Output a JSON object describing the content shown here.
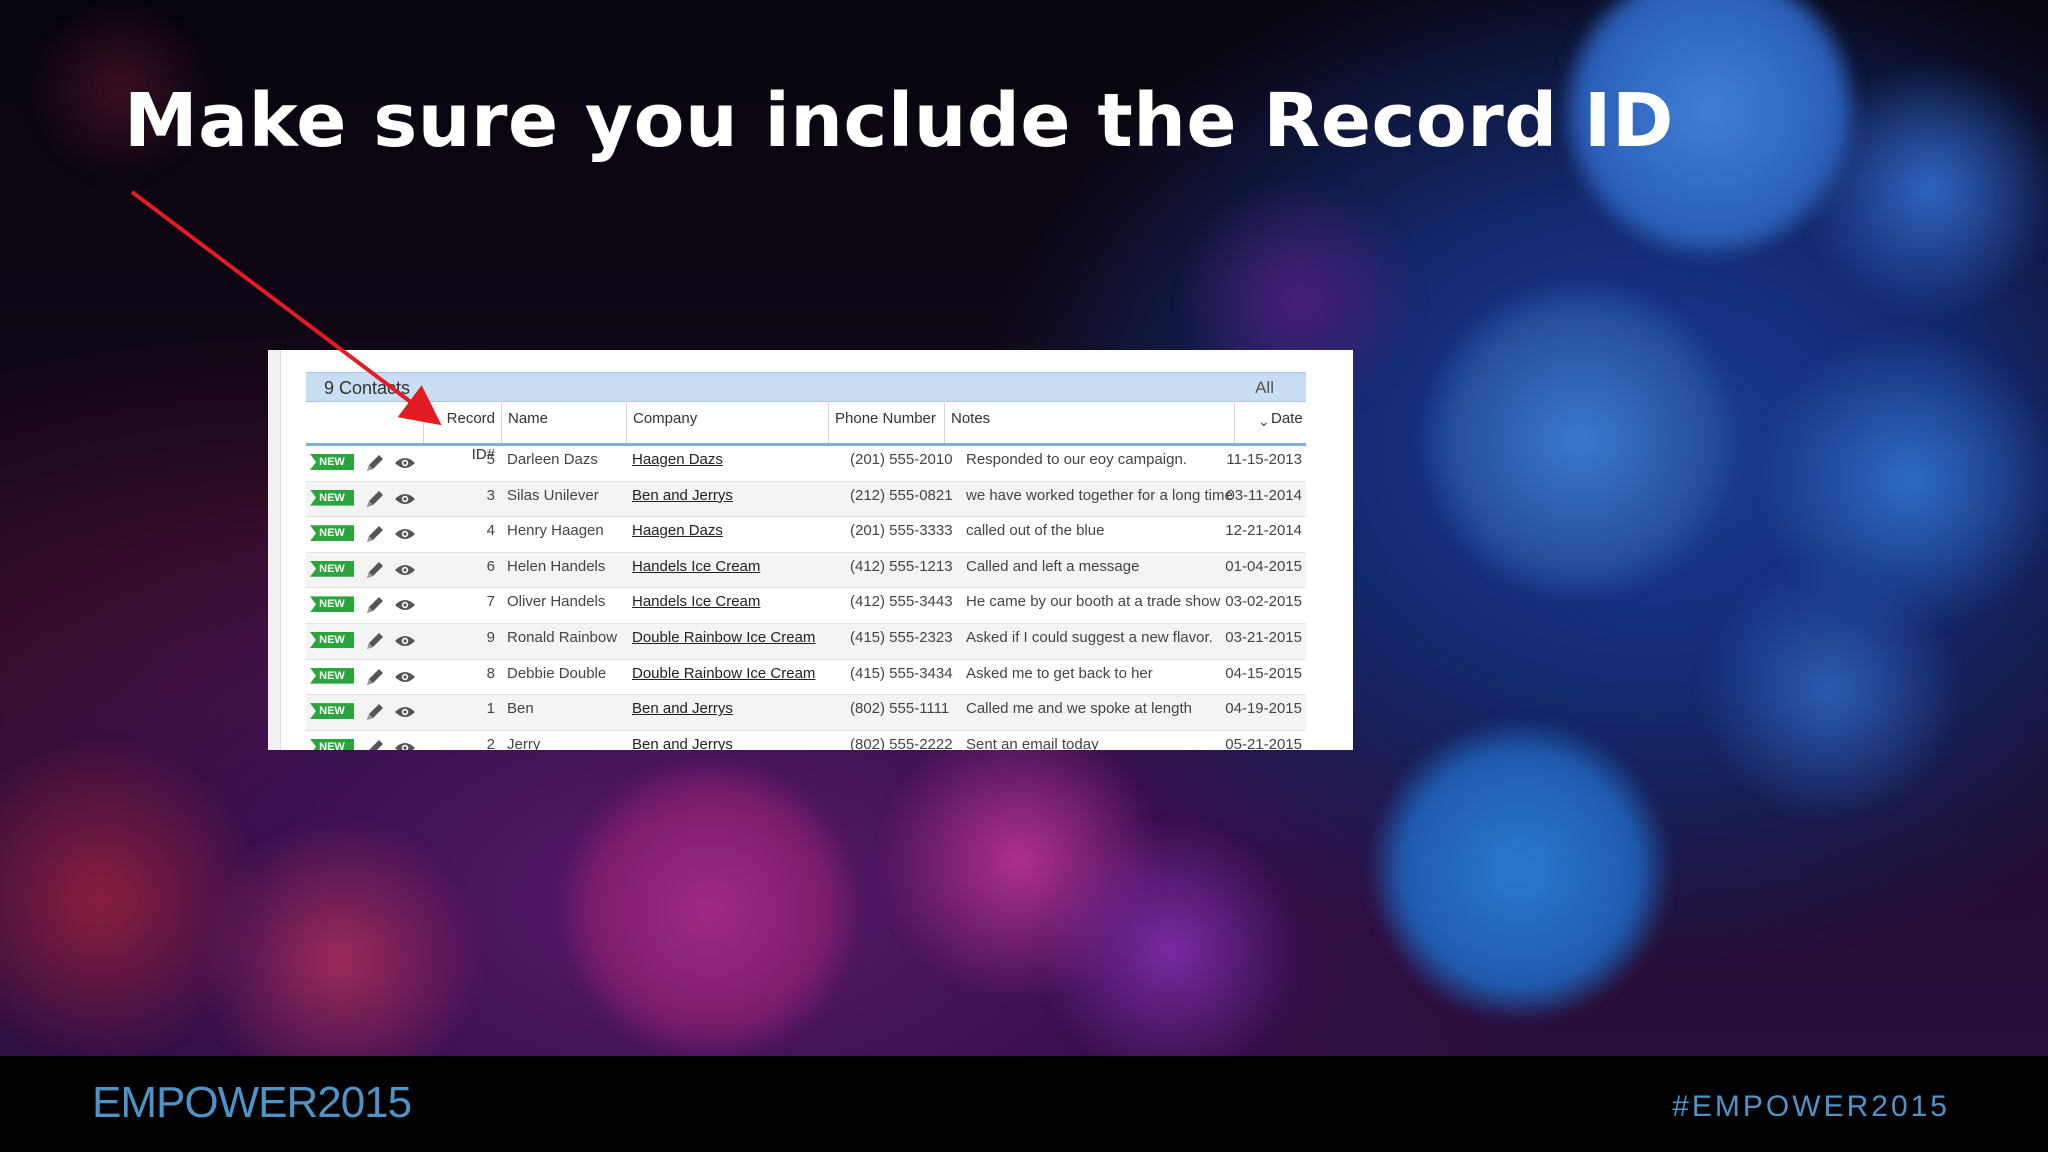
{
  "slide": {
    "title": "Make sure you include the Record ID"
  },
  "grid": {
    "count_label": "9 Contacts",
    "view_filter": "All",
    "columns": {
      "record_id": "Record ID#",
      "name": "Name",
      "company": "Company",
      "phone": "Phone Number",
      "notes": "Notes",
      "date": "Date"
    },
    "badge_label": "NEW",
    "rows": [
      {
        "id": "5",
        "name": "Darleen Dazs",
        "company": "Haagen Dazs",
        "phone": "(201) 555-2010",
        "notes": "Responded to our eoy campaign.",
        "date": "11-15-2013"
      },
      {
        "id": "3",
        "name": "Silas Unilever",
        "company": "Ben and Jerrys",
        "phone": "(212) 555-0821",
        "notes": "we have worked together for a long time",
        "date": "03-11-2014"
      },
      {
        "id": "4",
        "name": "Henry Haagen",
        "company": "Haagen Dazs",
        "phone": "(201) 555-3333",
        "notes": "called out of the blue",
        "date": "12-21-2014"
      },
      {
        "id": "6",
        "name": "Helen Handels",
        "company": "Handels Ice Cream",
        "phone": "(412) 555-1213",
        "notes": "Called and left a message",
        "date": "01-04-2015"
      },
      {
        "id": "7",
        "name": "Oliver Handels",
        "company": "Handels Ice Cream",
        "phone": "(412) 555-3443",
        "notes": "He came by our booth at a trade show",
        "date": "03-02-2015"
      },
      {
        "id": "9",
        "name": "Ronald Rainbow",
        "company": "Double Rainbow Ice Cream",
        "phone": "(415) 555-2323",
        "notes": "Asked if I could suggest a new flavor.",
        "date": "03-21-2015"
      },
      {
        "id": "8",
        "name": "Debbie Double",
        "company": "Double Rainbow Ice Cream",
        "phone": "(415) 555-3434",
        "notes": "Asked me to get back to her",
        "date": "04-15-2015"
      },
      {
        "id": "1",
        "name": "Ben",
        "company": "Ben and Jerrys",
        "phone": "(802) 555-1111",
        "notes": "Called me and we spoke at length",
        "date": "04-19-2015"
      },
      {
        "id": "2",
        "name": "Jerry",
        "company": "Ben and Jerrys",
        "phone": "(802) 555-2222",
        "notes": "Sent an email today",
        "date": "05-21-2015"
      }
    ]
  },
  "footer": {
    "logo_text": "EMPOWER2015",
    "hashtag": "#EMPOWER2015"
  },
  "colors": {
    "badge_green": "#2aa53b",
    "arrow_red": "#e31b23",
    "footer_blue": "#4d93c8",
    "grid_header_blue": "#c9def3"
  }
}
